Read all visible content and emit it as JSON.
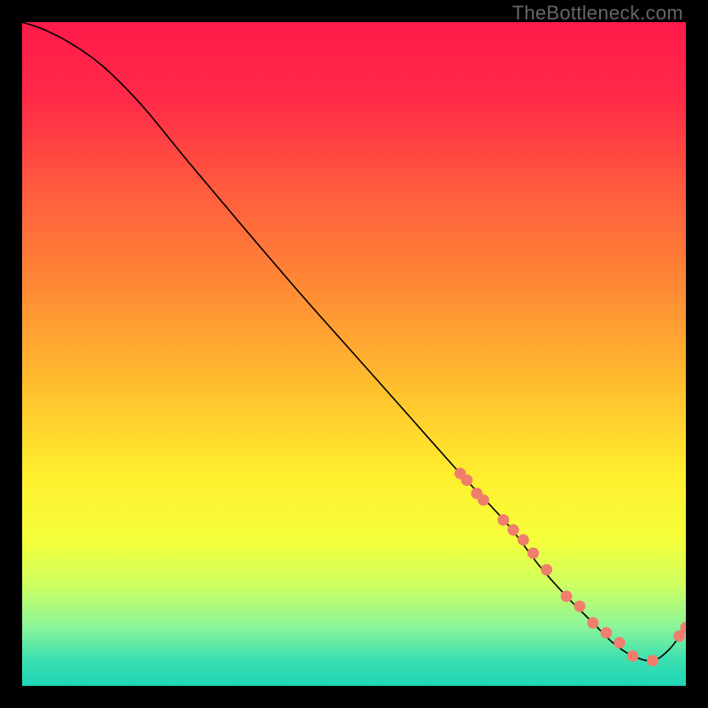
{
  "watermark": "TheBottleneck.com",
  "chart_data": {
    "type": "line",
    "title": "",
    "xlabel": "",
    "ylabel": "",
    "xlim": [
      0,
      100
    ],
    "ylim": [
      0,
      100
    ],
    "background_gradient": {
      "stops": [
        {
          "pos": 0.0,
          "color": "#ff1a4b"
        },
        {
          "pos": 0.12,
          "color": "#ff2b47"
        },
        {
          "pos": 0.25,
          "color": "#ff5a3e"
        },
        {
          "pos": 0.4,
          "color": "#ff8a35"
        },
        {
          "pos": 0.55,
          "color": "#ffbf2e"
        },
        {
          "pos": 0.68,
          "color": "#ffee2e"
        },
        {
          "pos": 0.78,
          "color": "#f5ff3a"
        },
        {
          "pos": 0.85,
          "color": "#ccff62"
        },
        {
          "pos": 0.91,
          "color": "#8cf59a"
        },
        {
          "pos": 0.96,
          "color": "#3de0b0"
        },
        {
          "pos": 1.0,
          "color": "#1dd6b6"
        }
      ]
    },
    "series": [
      {
        "name": "bottleneck-curve",
        "x": [
          0,
          3,
          7,
          12,
          18,
          25,
          33,
          42,
          50,
          58,
          66,
          73,
          78,
          82,
          86,
          89,
          92,
          95,
          97.5,
          100
        ],
        "y": [
          100,
          99,
          97,
          93.5,
          87.5,
          79,
          69.5,
          59,
          50,
          41,
          32,
          24.5,
          18,
          13.5,
          9.5,
          6.5,
          4.5,
          3.8,
          5.5,
          8.8
        ]
      }
    ],
    "points": {
      "name": "highlight-points",
      "color": "#ef7e6d",
      "x": [
        66,
        67,
        68.5,
        69.5,
        72.5,
        74,
        75.5,
        77,
        79,
        82,
        84,
        86,
        88,
        90,
        92,
        95,
        99,
        100
      ],
      "y": [
        32,
        31,
        29,
        28,
        25,
        23.5,
        22,
        20,
        17.5,
        13.5,
        12,
        9.5,
        8,
        6.5,
        4.5,
        3.8,
        7.5,
        8.8
      ]
    }
  }
}
